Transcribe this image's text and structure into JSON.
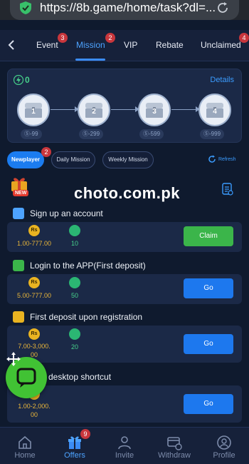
{
  "browser": {
    "url": "https://8b.game/home/task?dl=..."
  },
  "tabs": [
    {
      "label": "Event",
      "badge": "3"
    },
    {
      "label": "Mission",
      "badge": "2"
    },
    {
      "label": "VIP",
      "badge": ""
    },
    {
      "label": "Rebate",
      "badge": ""
    },
    {
      "label": "Unclaimed",
      "badge": "4"
    }
  ],
  "chests": {
    "points": "0",
    "details_label": "Details",
    "items": [
      {
        "number": "1",
        "cost": "99"
      },
      {
        "number": "2",
        "cost": "299"
      },
      {
        "number": "3",
        "cost": "599"
      },
      {
        "number": "4",
        "cost": "999"
      }
    ]
  },
  "subtabs": {
    "items": [
      "Newplayer",
      "Daily Mission",
      "Weekly Mission"
    ],
    "newplayer_badge": "2",
    "refresh_label": "Refresh"
  },
  "gift": {
    "new_label": "NEW"
  },
  "watermark": "choto.com.pk",
  "tasks": [
    {
      "title": "Sign up an account",
      "reward": "1.00-777.00",
      "points": "10",
      "button": "Claim"
    },
    {
      "title": "Login to the APP(First deposit)",
      "reward": "5.00-777.00",
      "points": "50",
      "button": "Go"
    },
    {
      "title": "First deposit upon registration",
      "reward_line1": "7.00-3,000.",
      "reward_line2": "00",
      "points": "20",
      "button": "Go"
    },
    {
      "title": "desktop shortcut",
      "reward_line1": "1.00-2,000.",
      "reward_line2": "00",
      "points": "",
      "button": "Go"
    }
  ],
  "coin_label": "Rs",
  "bottom_nav": {
    "items": [
      "Home",
      "Offers",
      "Invite",
      "Withdraw",
      "Profile"
    ],
    "offers_badge": "9"
  },
  "colors": {
    "background": "#0f1a2e",
    "accent": "#1d78ee",
    "claim": "#3bb54a",
    "points": "#46d18b",
    "coin": "#e9b321",
    "badge": "#c8363c"
  }
}
